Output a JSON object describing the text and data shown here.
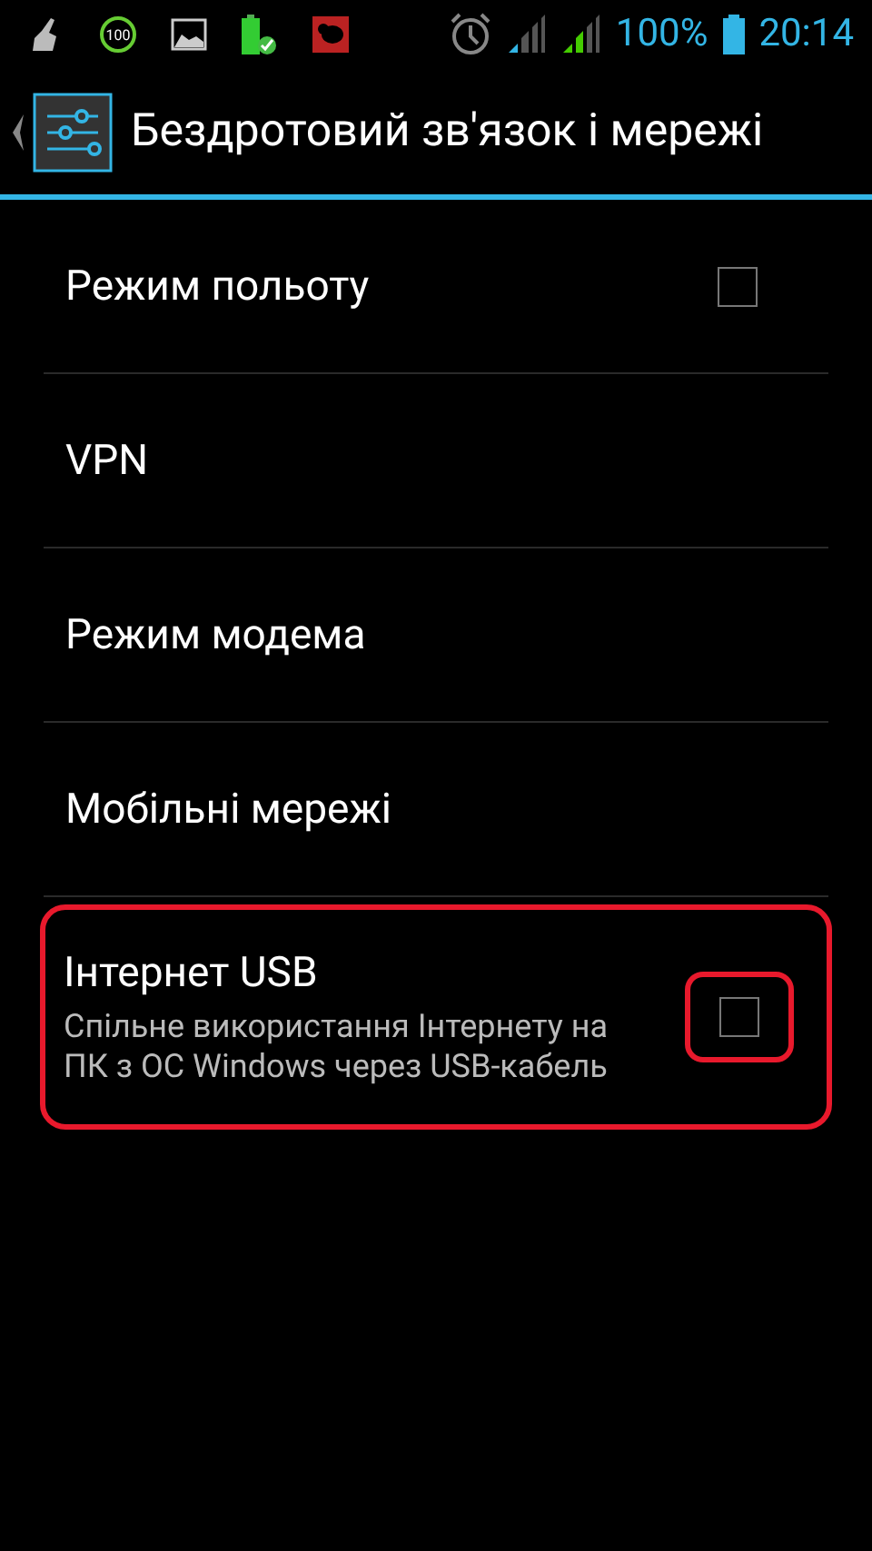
{
  "status_bar": {
    "notification_badge": "100",
    "battery_percent": "100%",
    "time": "20:14"
  },
  "action_bar": {
    "title": "Бездротовий зв'язок і мережі"
  },
  "items": [
    {
      "kind": "checkbox",
      "title": "Режим польоту",
      "checked": false,
      "highlighted": false
    },
    {
      "kind": "link",
      "title": "VPN",
      "highlighted": false
    },
    {
      "kind": "link",
      "title": "Режим модема",
      "highlighted": false
    },
    {
      "kind": "link",
      "title": "Мобільні мережі",
      "highlighted": false
    },
    {
      "kind": "checkbox",
      "title": "Інтернет USB",
      "summary": "Спільне використання Інтернету на ПК з ОС Windows через USB-кабель",
      "checked": false,
      "highlighted": true
    }
  ]
}
